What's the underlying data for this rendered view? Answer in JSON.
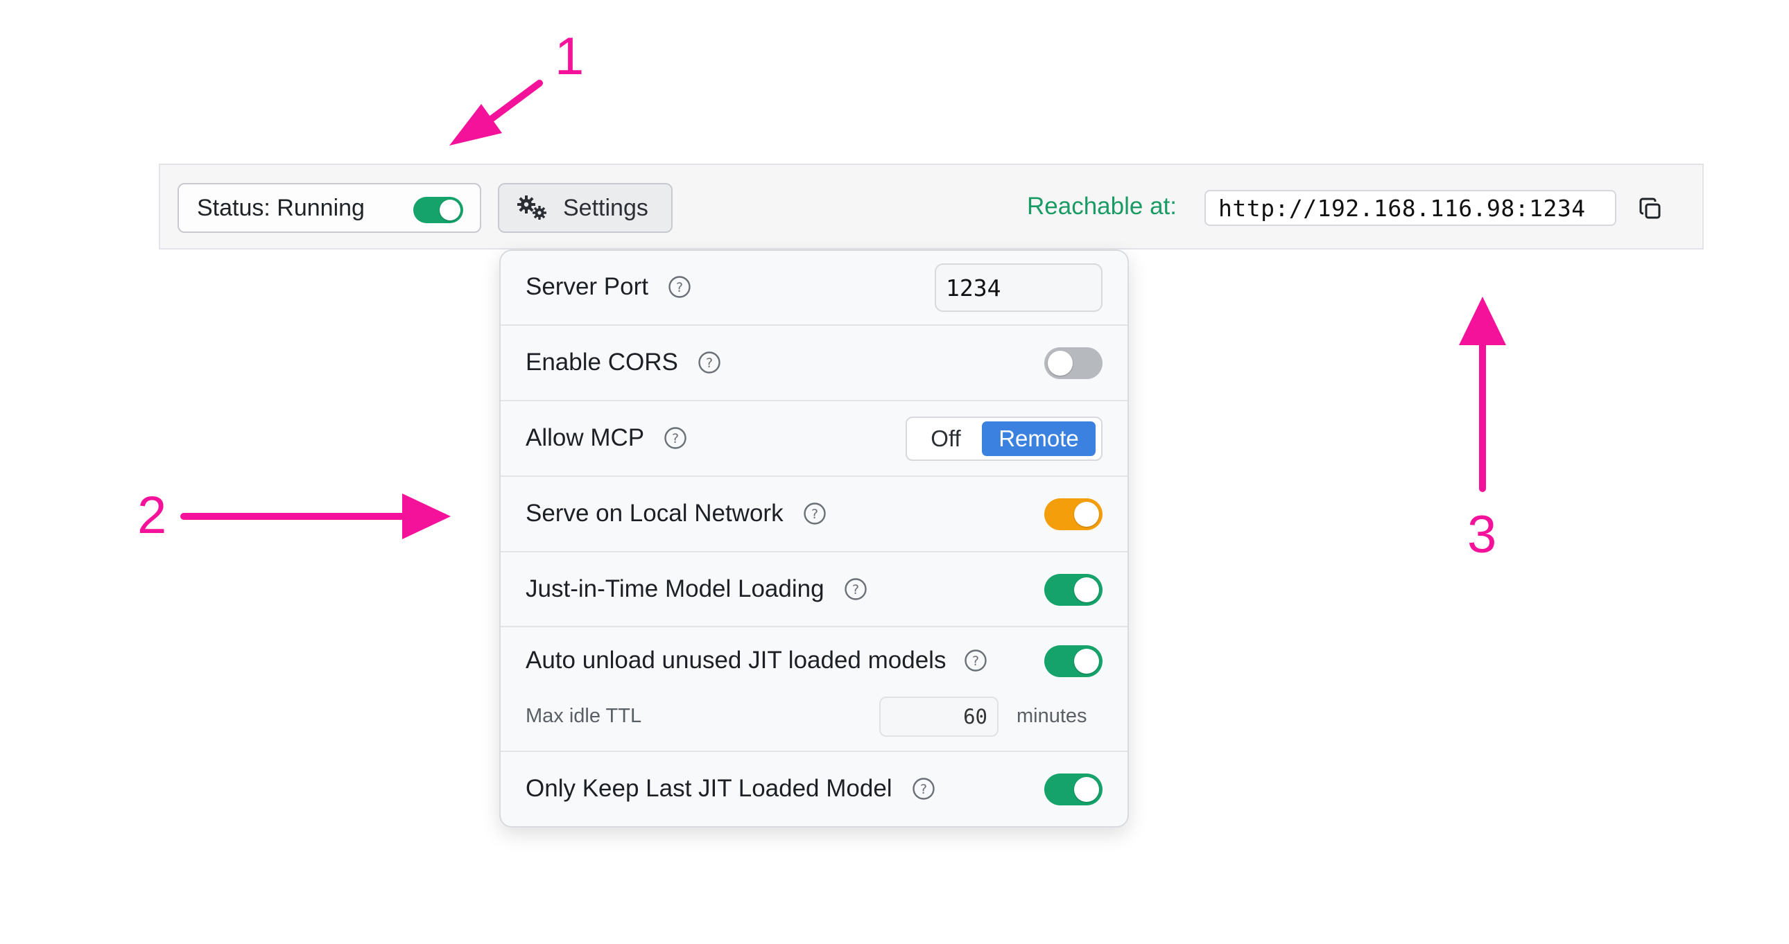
{
  "topbar": {
    "status_label": "Status: Running",
    "status_on": true,
    "settings_label": "Settings",
    "reachable_label": "Reachable at:",
    "url": "http://192.168.116.98:1234"
  },
  "settings": {
    "server_port": {
      "label": "Server Port",
      "value": "1234"
    },
    "enable_cors": {
      "label": "Enable CORS",
      "on": false
    },
    "allow_mcp": {
      "label": "Allow MCP",
      "options": [
        "Off",
        "Remote"
      ],
      "selected": "Remote"
    },
    "serve_local_network": {
      "label": "Serve on Local Network",
      "on": true
    },
    "jit_loading": {
      "label": "Just-in-Time Model Loading",
      "on": true
    },
    "auto_unload": {
      "label": "Auto unload unused JIT loaded models",
      "on": true,
      "ttl_label": "Max idle TTL",
      "ttl_value": "60",
      "ttl_unit": "minutes"
    },
    "only_keep_last": {
      "label": "Only Keep Last JIT Loaded Model",
      "on": true
    }
  },
  "annotations": {
    "a1": "1",
    "a2": "2",
    "a3": "3"
  },
  "colors": {
    "toggle_green": "#15a36b",
    "toggle_orange": "#f59e0b",
    "toggle_off": "#b6b9be",
    "accent_blue": "#3b82e0",
    "reachable_green": "#1a9b65",
    "annotation_pink": "#f5129a"
  }
}
